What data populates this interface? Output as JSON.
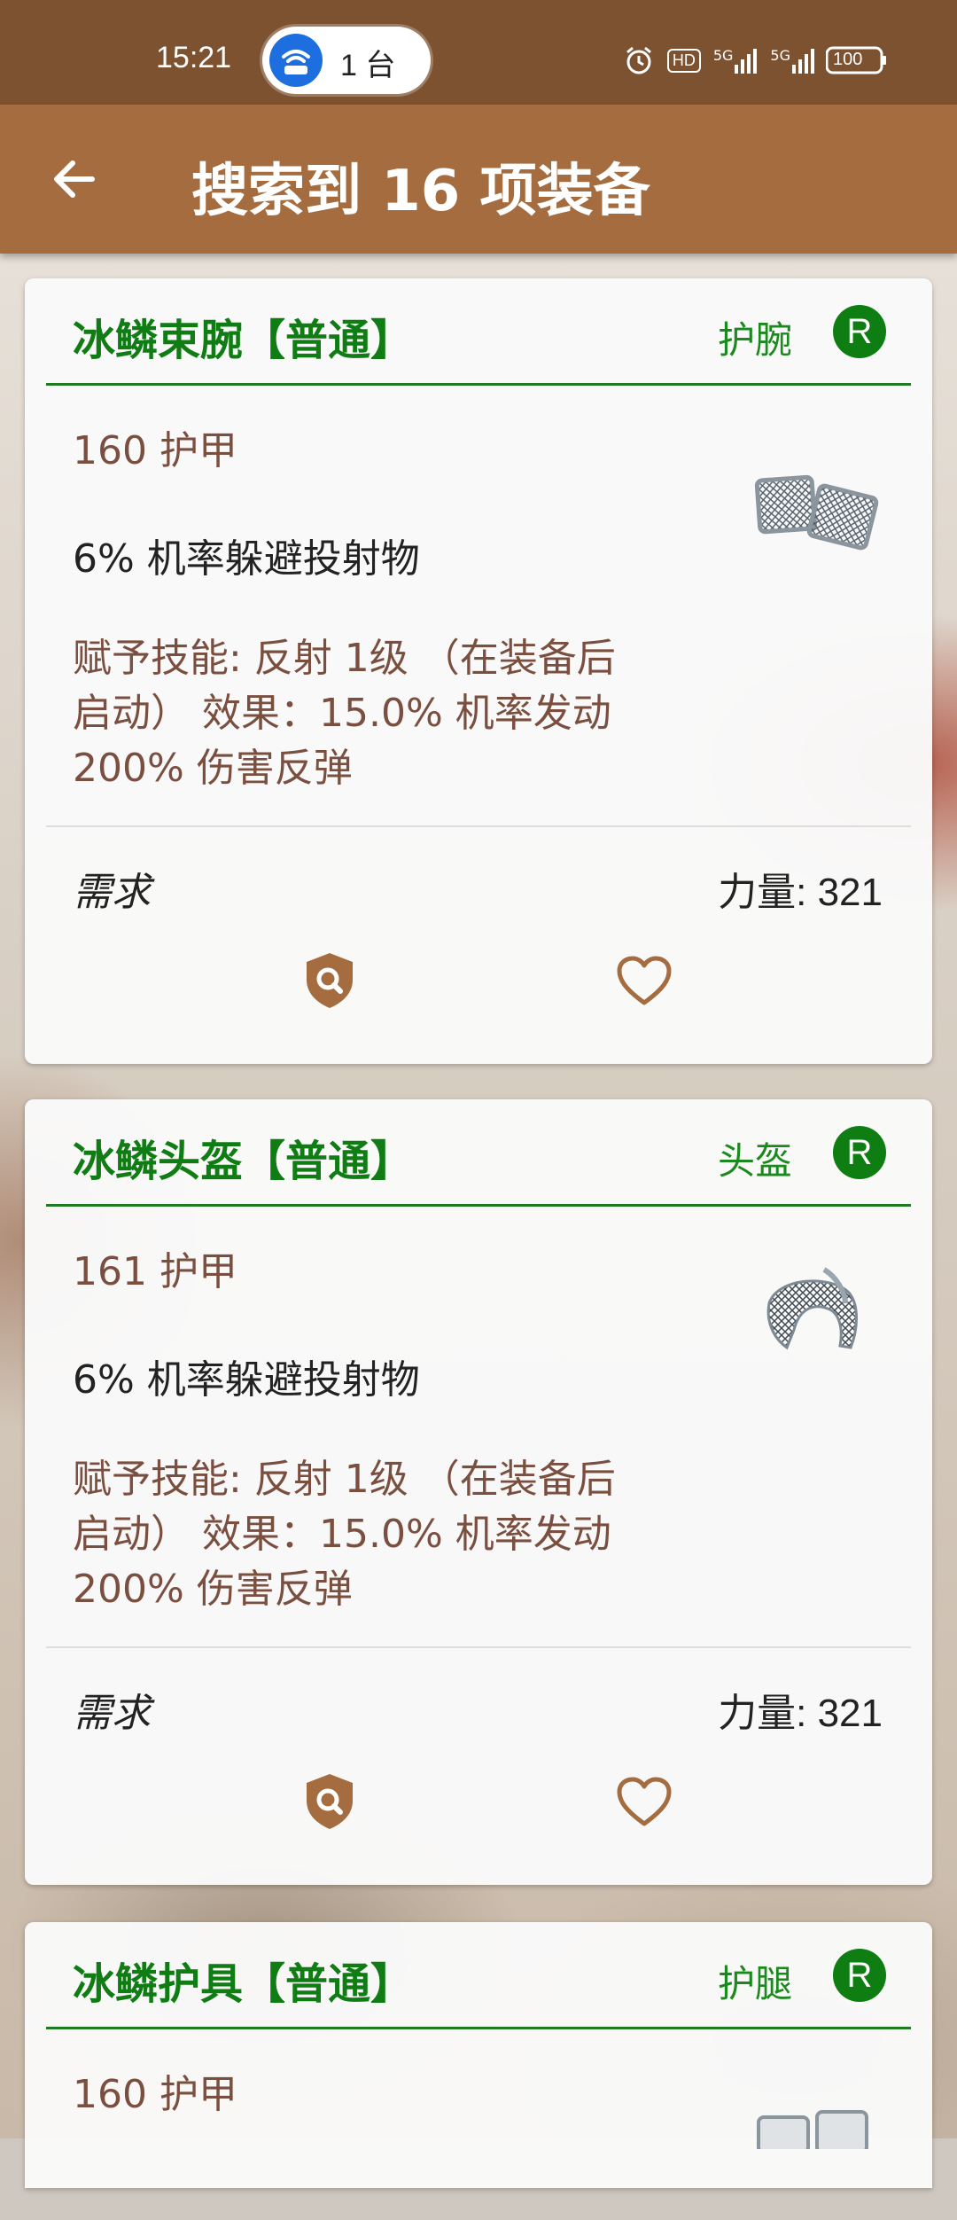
{
  "status_bar": {
    "time": "15:21",
    "hotspot_count": "1 台",
    "hd_label": "HD",
    "network_label": "5G",
    "battery": "100"
  },
  "app_bar": {
    "title": "搜索到 16 项装备"
  },
  "items": [
    {
      "name": "冰鳞束腕【普通】",
      "slot": "护腕",
      "rank": "R",
      "armor": "160 护甲",
      "effect": "6% 机率躲避投射物",
      "skill_lines": [
        "赋予技能: 反射 1级 （在装备后",
        "启动） 效果：15.0% 机率发动",
        "200% 伤害反弹"
      ],
      "requirement_label": "需求",
      "requirement_value": "力量: 321"
    },
    {
      "name": "冰鳞头盔【普通】",
      "slot": "头盔",
      "rank": "R",
      "armor": "161 护甲",
      "effect": "6% 机率躲避投射物",
      "skill_lines": [
        "赋予技能: 反射 1级 （在装备后",
        "启动） 效果：15.0% 机率发动",
        "200% 伤害反弹"
      ],
      "requirement_label": "需求",
      "requirement_value": "力量: 321"
    },
    {
      "name": "冰鳞护具【普通】",
      "slot": "护腿",
      "rank": "R",
      "armor": "160 护甲"
    }
  ],
  "colors": {
    "appbar": "#a56d3f",
    "statusbar": "#7d5231",
    "green": "#0f7d14",
    "brown_text": "#7a4f3f",
    "icon": "#a56d3f"
  },
  "icons": {
    "back": "arrow-left-icon",
    "details": "shield-search-icon",
    "favorite": "heart-outline-icon"
  }
}
